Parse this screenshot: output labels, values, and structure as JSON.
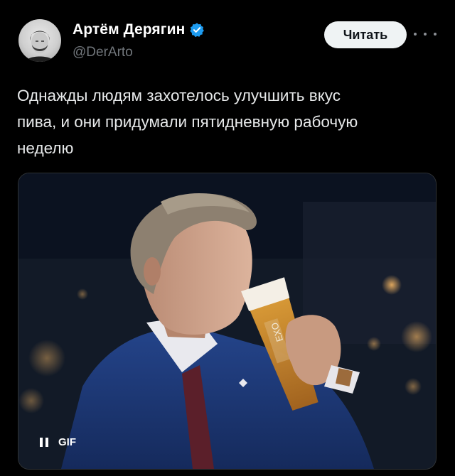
{
  "author": {
    "display_name": "Артём Дерягин",
    "handle": "@DerArto",
    "verified": true
  },
  "follow_button_label": "Читать",
  "more_icon": "ellipsis-icon",
  "tweet_text": "Однажды людям захотелось улучшить вкус\nпива, и они придумали пятидневную рабочую\nнеделю",
  "media": {
    "type": "gif",
    "badge_label": "GIF",
    "controls_icon": "pause-icon",
    "glass_label": "EXO"
  },
  "colors": {
    "background": "#000000",
    "verified_badge": "#1d9bf0",
    "follow_button_bg": "#eff3f4",
    "secondary_text": "#71767b"
  }
}
